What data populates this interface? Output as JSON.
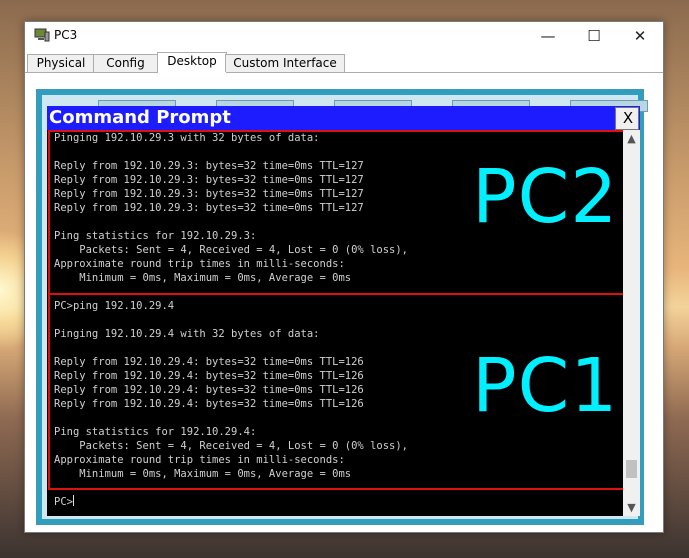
{
  "window": {
    "title": "PC3",
    "controls": {
      "minimize": "—",
      "maximize": "☐",
      "close": "✕"
    }
  },
  "tabs": [
    {
      "label": "Physical",
      "selected": false
    },
    {
      "label": "Config",
      "selected": false
    },
    {
      "label": "Desktop",
      "selected": true
    },
    {
      "label": "Custom Interface",
      "selected": false
    }
  ],
  "command_prompt": {
    "title": "Command Prompt",
    "close_label": "X",
    "lines": [
      "Pinging 192.10.29.3 with 32 bytes of data:",
      "",
      "Reply from 192.10.29.3: bytes=32 time=0ms TTL=127",
      "Reply from 192.10.29.3: bytes=32 time=0ms TTL=127",
      "Reply from 192.10.29.3: bytes=32 time=0ms TTL=127",
      "Reply from 192.10.29.3: bytes=32 time=0ms TTL=127",
      "",
      "Ping statistics for 192.10.29.3:",
      "    Packets: Sent = 4, Received = 4, Lost = 0 (0% loss),",
      "Approximate round trip times in milli-seconds:",
      "    Minimum = 0ms, Maximum = 0ms, Average = 0ms",
      "",
      "PC>ping 192.10.29.4",
      "",
      "Pinging 192.10.29.4 with 32 bytes of data:",
      "",
      "Reply from 192.10.29.4: bytes=32 time=0ms TTL=126",
      "Reply from 192.10.29.4: bytes=32 time=0ms TTL=126",
      "Reply from 192.10.29.4: bytes=32 time=0ms TTL=126",
      "Reply from 192.10.29.4: bytes=32 time=0ms TTL=126",
      "",
      "Ping statistics for 192.10.29.4:",
      "    Packets: Sent = 4, Received = 4, Lost = 0 (0% loss),",
      "Approximate round trip times in milli-seconds:",
      "    Minimum = 0ms, Maximum = 0ms, Average = 0ms",
      "",
      "PC>"
    ],
    "annotations": {
      "upper": "PC2",
      "lower": "PC1"
    },
    "scrollbar": {
      "up": "▲",
      "down": "▼"
    }
  },
  "colors": {
    "title_bar_blue": "#1c1cff",
    "annotation_text": "#00f0ff",
    "highlight_border": "#e01010"
  }
}
